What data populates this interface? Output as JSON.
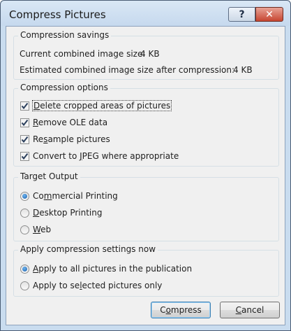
{
  "window": {
    "title": "Compress Pictures",
    "help_label": "?",
    "close_label": "✕"
  },
  "savings": {
    "group_label": "Compression savings",
    "current_label": "Current combined image size:",
    "current_value": "4 KB",
    "estimated_label": "Estimated combined image size after compression:",
    "estimated_value": "4 KB"
  },
  "options": {
    "group_label": "Compression options",
    "items": [
      {
        "pre": "",
        "mnemonic": "D",
        "post": "elete cropped areas of pictures",
        "checked": true
      },
      {
        "pre": "",
        "mnemonic": "R",
        "post": "emove OLE data",
        "checked": true
      },
      {
        "pre": "Re",
        "mnemonic": "s",
        "post": "ample pictures",
        "checked": true
      },
      {
        "pre": "Convert to ",
        "mnemonic": "J",
        "post": "PEG where appropriate",
        "checked": true
      }
    ]
  },
  "target": {
    "group_label": "Target Output",
    "items": [
      {
        "pre": "Co",
        "mnemonic": "m",
        "post": "mercial Printing",
        "selected": true
      },
      {
        "pre": "",
        "mnemonic": "D",
        "post": "esktop Printing",
        "selected": false
      },
      {
        "pre": "",
        "mnemonic": "W",
        "post": "eb",
        "selected": false
      }
    ]
  },
  "apply": {
    "group_label": "Apply compression settings now",
    "items": [
      {
        "pre": "",
        "mnemonic": "A",
        "post": "pply to all pictures in the publication",
        "selected": true
      },
      {
        "pre": "Apply to se",
        "mnemonic": "l",
        "post": "ected pictures only",
        "selected": false
      }
    ]
  },
  "buttons": {
    "compress": {
      "pre": "C",
      "mnemonic": "o",
      "post": "mpress"
    },
    "cancel": {
      "pre": "",
      "mnemonic": "C",
      "post": "ancel"
    }
  },
  "colors": {
    "frame": "#c9dcef",
    "close_button": "#c74631",
    "radio_dot": "#1e5fa8"
  }
}
